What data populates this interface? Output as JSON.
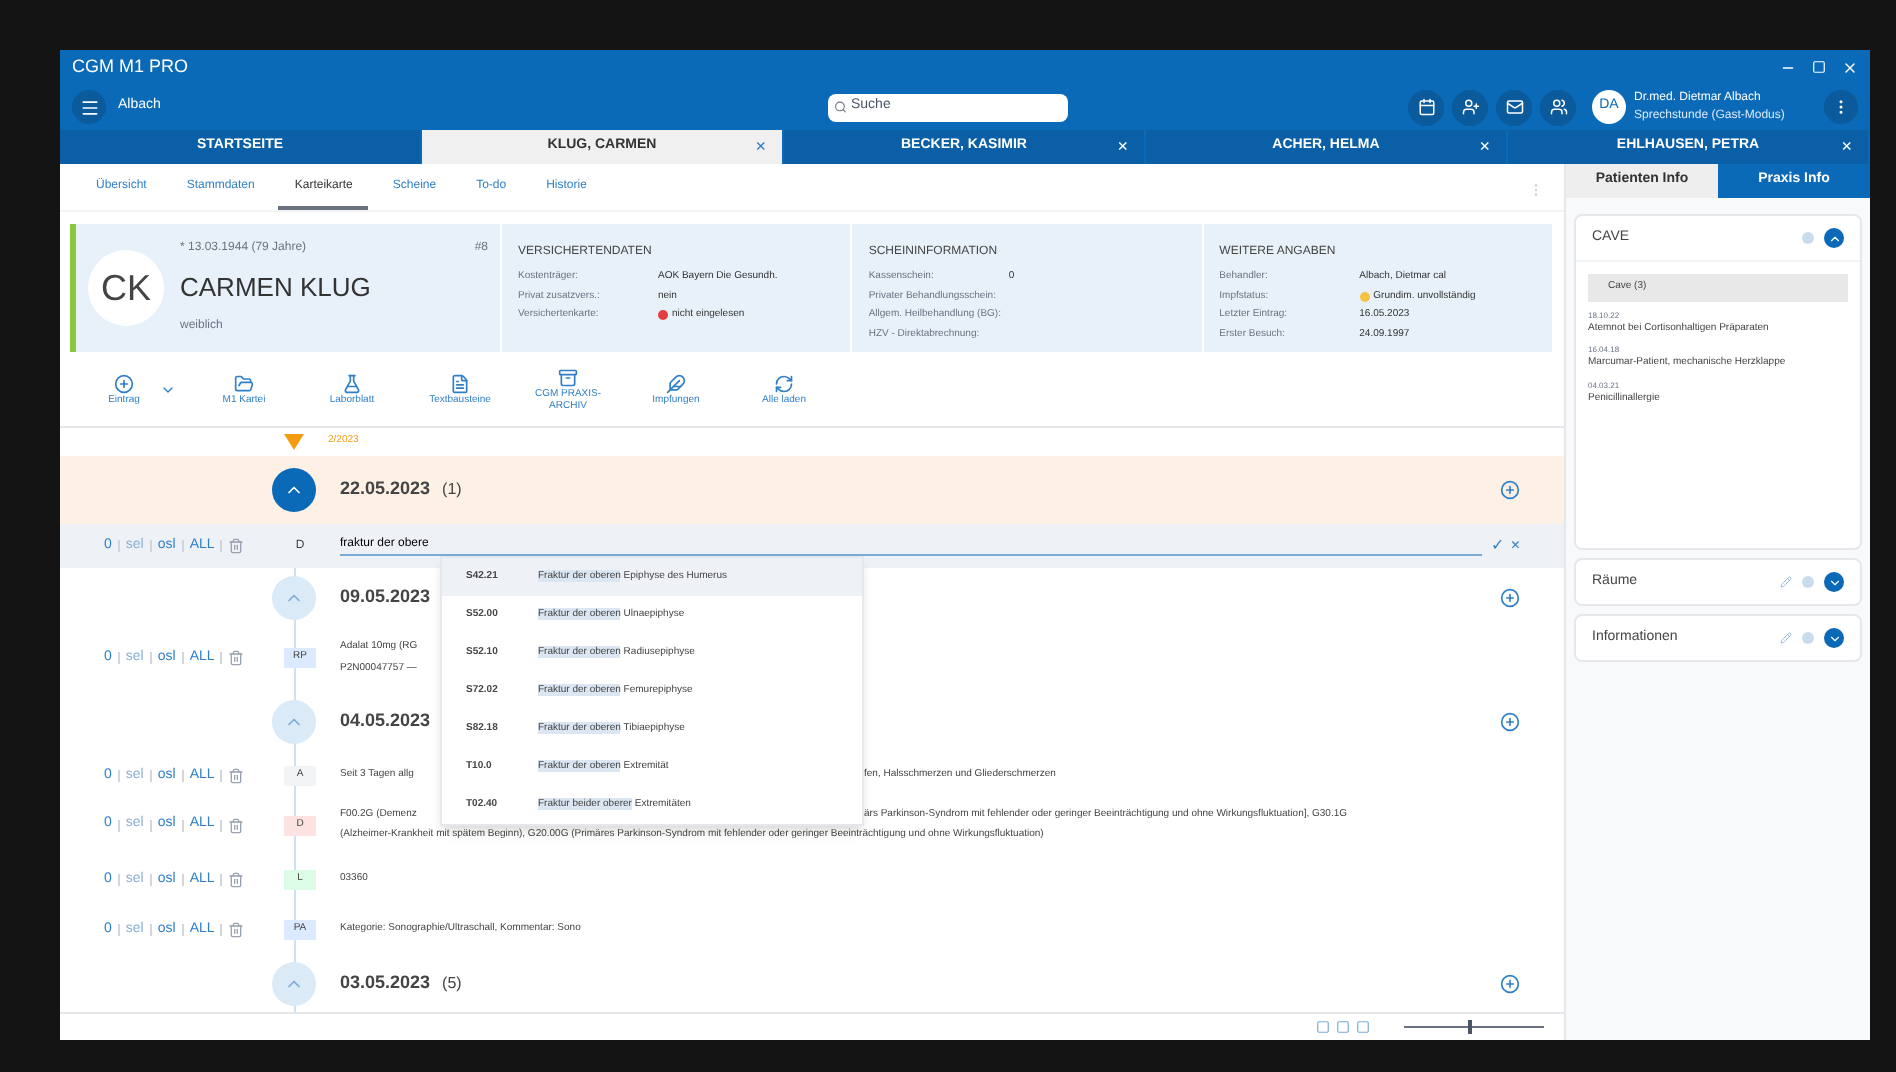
{
  "window": {
    "title": "CGM M1 PRO",
    "user_location": "Albach",
    "search_placeholder": "Suche",
    "user_initials": "DA",
    "user_name": "Dr.med. Dietmar Albach",
    "user_role": "Sprechstunde (Gast-Modus)"
  },
  "patient_tabs": [
    {
      "label": "STARTSEITE",
      "selected": false
    },
    {
      "label": "KLUG, CARMEN",
      "selected": true,
      "close": "×"
    },
    {
      "label": "BECKER, KASIMIR",
      "selected": false,
      "close": "×"
    },
    {
      "label": "ACHER, HELMA",
      "selected": false,
      "close": "×"
    },
    {
      "label": "EHLHAUSEN, PETRA",
      "selected": false,
      "close": "×"
    }
  ],
  "sub_tabs": [
    {
      "label": "Übersicht",
      "selected": false
    },
    {
      "label": "Stammdaten",
      "selected": false
    },
    {
      "label": "Karteikarte",
      "selected": true
    },
    {
      "label": "Scheine",
      "selected": false
    },
    {
      "label": "To-do",
      "selected": false
    },
    {
      "label": "Historie",
      "selected": false
    }
  ],
  "patient": {
    "initials": "CK",
    "birth": "* 13.03.1944 (79 Jahre)",
    "number": "#8",
    "name": "CARMEN KLUG",
    "gender": "weiblich",
    "sections": [
      {
        "title": "VERSICHERTENDATEN",
        "rows": [
          {
            "label": "Kostenträger:",
            "value": "AOK Bayern Die Gesundh.",
            "kind": "plain"
          },
          {
            "label": "Privat zusatzvers.:",
            "value": "nein",
            "kind": "plain"
          },
          {
            "label": "Versichertenkarte:",
            "value": "nicht eingelesen",
            "kind": "error"
          }
        ]
      },
      {
        "title": "SCHEININFORMATION",
        "rows": [
          {
            "label": "Kassenschein:",
            "value": "0",
            "kind": "plain"
          },
          {
            "label": "Privater Behandlungsschein:",
            "kind": "plain"
          },
          {
            "label": "Allgem. Heilbehandlung (BG):",
            "kind": "plain"
          },
          {
            "label": "HZV - Direktabrechnung:",
            "kind": "plain"
          }
        ]
      },
      {
        "title": "WEITERE ANGABEN",
        "rows": [
          {
            "label": "Behandler:",
            "value": "Albach, Dietmar cal",
            "kind": "plain"
          },
          {
            "label": "Impfstatus:",
            "value": "Grundim. unvollständig",
            "kind": "warning"
          },
          {
            "label": "Letzter Eintrag:",
            "value": "16.05.2023",
            "kind": "plain"
          },
          {
            "label": "Erster Besuch:",
            "value": "24.09.1997",
            "kind": "plain"
          }
        ]
      }
    ]
  },
  "toolbar": [
    {
      "label": "Eintrag"
    },
    {
      "label": "M1 Kartei"
    },
    {
      "label": "Laborblatt"
    },
    {
      "label": "Textbausteine"
    },
    {
      "label": "CGM PRAXIS-ARCHIV"
    },
    {
      "label": "Impfungen"
    },
    {
      "label": "Alle laden"
    }
  ],
  "timeline": {
    "quarter": "2/2023",
    "items": [
      {
        "kind": "date",
        "date": "22.05.2023",
        "count": "(1)",
        "expanded": true,
        "highlight": true
      },
      {
        "kind": "edit",
        "actions": [
          "0",
          "sel",
          "osl",
          "ALL"
        ],
        "badge": "D",
        "value": "fraktur der obere",
        "confirm": "✓",
        "cancel": "×"
      },
      {
        "kind": "date",
        "date": "09.05.2023",
        "expanded": false,
        "highlight": false
      },
      {
        "kind": "entry",
        "actions": [
          "0",
          "sel",
          "osl",
          "ALL"
        ],
        "badge": "RP",
        "color": "#dbeafe",
        "lines": [
          "Adalat 10mg (RG",
          "P2N00047757 —"
        ]
      },
      {
        "kind": "date",
        "date": "04.05.2023",
        "expanded": false,
        "highlight": false
      },
      {
        "kind": "entry",
        "actions": [
          "0",
          "sel",
          "osl",
          "ALL"
        ],
        "badge": "A",
        "color": "#f3f4f6",
        "lines": [
          "Seit 3 Tagen allg"
        ],
        "end": "fen, Halsschmerzen und Gliederschmerzen"
      },
      {
        "kind": "entry",
        "actions": [
          "0",
          "sel",
          "osl",
          "ALL"
        ],
        "badge": "D",
        "color": "#fde2e2",
        "lines": [
          "F00.2G (Demenz",
          "(Alzheimer-Krankheit mit spätem Beginn), G20.00G (Primäres Parkinson-Syndrom mit fehlender oder geringer Beeinträchtigung und ohne Wirkungsfluktuation)"
        ],
        "end": "ärs Parkinson-Syndrom mit fehlender oder geringer Beeinträchtigung und ohne Wirkungsfluktuation], G30.1G"
      },
      {
        "kind": "entry",
        "actions": [
          "0",
          "sel",
          "osl",
          "ALL"
        ],
        "badge": "L",
        "color": "#dcfce7",
        "lines": [
          "03360"
        ]
      },
      {
        "kind": "entry",
        "actions": [
          "0",
          "sel",
          "osl",
          "ALL"
        ],
        "badge": "PA",
        "color": "#dbeafe",
        "lines": [
          "Kategorie: Sonographie/Ultraschall, Kommentar: Sono"
        ]
      },
      {
        "kind": "date",
        "date": "03.05.2023",
        "count": "(5)",
        "expanded": false,
        "highlight": false
      }
    ]
  },
  "suggestions": [
    {
      "code": "S42.21",
      "match": "Fraktur der oberen",
      "rest": " Epiphyse des Humerus",
      "selected": true
    },
    {
      "code": "S52.00",
      "match": "Fraktur der oberen",
      "rest": " Ulnaepiphyse",
      "selected": false
    },
    {
      "code": "S52.10",
      "match": "Fraktur der oberen",
      "rest": " Radiusepiphyse",
      "selected": false
    },
    {
      "code": "S72.02",
      "match": "Fraktur der oberen",
      "rest": " Femurepiphyse",
      "selected": false
    },
    {
      "code": "S82.18",
      "match": "Fraktur der oberen",
      "rest": " Tibiaepiphyse",
      "selected": false
    },
    {
      "code": "T10.0",
      "match": "Fraktur der oberen",
      "rest": " Extremität",
      "selected": false
    },
    {
      "code": "T02.40",
      "match": "Fraktur beider oberer",
      "rest": " Extremitäten",
      "selected": false
    }
  ],
  "side_tabs": [
    {
      "label": "Patienten Info",
      "selected": true
    },
    {
      "label": "Praxis Info",
      "selected": false
    }
  ],
  "side_panels": [
    {
      "title": "CAVE",
      "expanded": true,
      "editable": false,
      "group": "Cave  (3)",
      "notes": [
        {
          "time": "18.10.22",
          "text": "Atemnot bei Cortisonhaltigen Präparaten"
        },
        {
          "time": "16.04.18",
          "text": "Marcumar-Patient, mechanische Herzklappe"
        },
        {
          "time": "04.03.21",
          "text": "Penicillinallergie"
        }
      ]
    },
    {
      "title": "Räume",
      "expanded": false,
      "editable": true
    },
    {
      "title": "Informationen",
      "expanded": false,
      "editable": true
    }
  ],
  "zoom": {
    "level": 0.45
  }
}
